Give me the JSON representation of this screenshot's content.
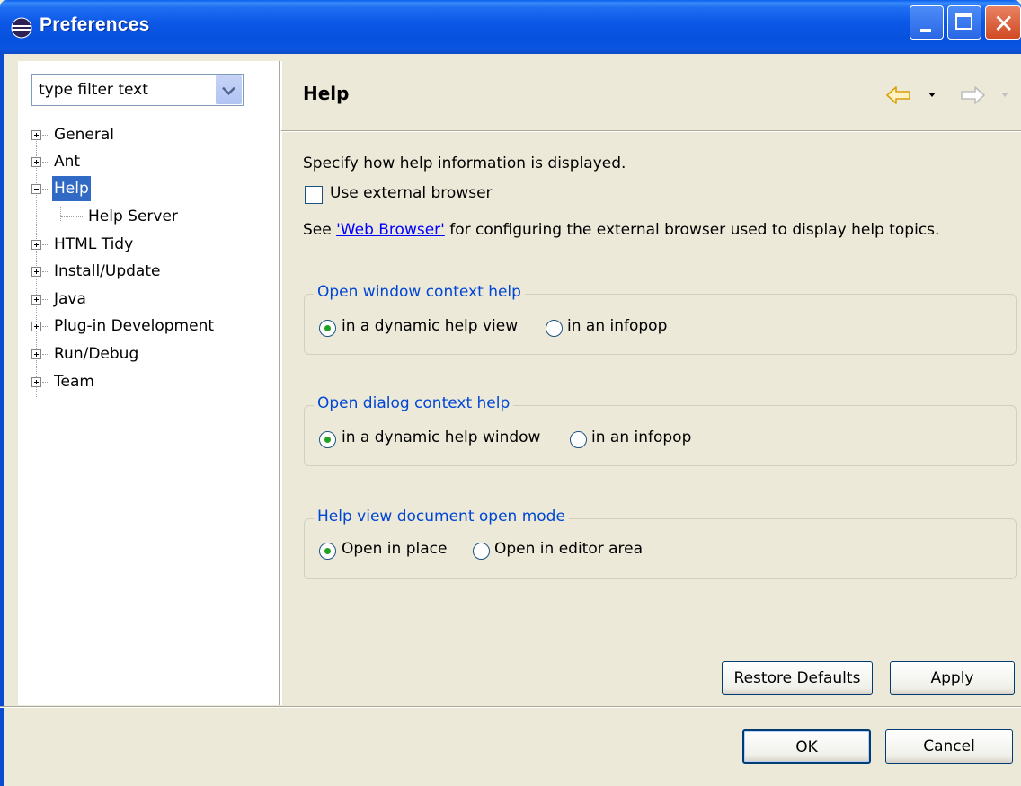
{
  "window": {
    "title": "Preferences"
  },
  "filter": {
    "value": "type filter text"
  },
  "tree": {
    "items": [
      {
        "label": "General",
        "expanded": false,
        "selected": false
      },
      {
        "label": "Ant",
        "expanded": false,
        "selected": false
      },
      {
        "label": "Help",
        "expanded": true,
        "selected": true
      },
      {
        "label": "Help Server",
        "child": true
      },
      {
        "label": "HTML Tidy",
        "expanded": false,
        "selected": false
      },
      {
        "label": "Install/Update",
        "expanded": false,
        "selected": false
      },
      {
        "label": "Java",
        "expanded": false,
        "selected": false
      },
      {
        "label": "Plug-in Development",
        "expanded": false,
        "selected": false
      },
      {
        "label": "Run/Debug",
        "expanded": false,
        "selected": false
      },
      {
        "label": "Team",
        "expanded": false,
        "selected": false
      }
    ]
  },
  "page": {
    "title": "Help",
    "description": "Specify how help information is displayed.",
    "external_browser_label": "Use external browser",
    "external_browser_checked": false,
    "see_prefix": "See ",
    "see_link": "'Web Browser'",
    "see_suffix": " for configuring the external browser used to display help topics."
  },
  "groups": {
    "window_help": {
      "title": "Open window context help",
      "option1": "in a dynamic help view",
      "option2": "in an infopop",
      "selected": "option1"
    },
    "dialog_help": {
      "title": "Open dialog context help",
      "option1": "in a dynamic help window",
      "option2": "in an infopop",
      "selected": "option1"
    },
    "doc_mode": {
      "title": "Help view document open mode",
      "option1": "Open in place",
      "option2": "Open in editor area",
      "selected": "option1"
    }
  },
  "buttons": {
    "restore_defaults": "Restore Defaults",
    "apply": "Apply",
    "ok": "OK",
    "cancel": "Cancel"
  },
  "colors": {
    "titlebar": "#0A55E2",
    "selection": "#316AC5",
    "group_title": "#0046D5",
    "link": "#0000FF",
    "radio_dot": "#21A121"
  }
}
